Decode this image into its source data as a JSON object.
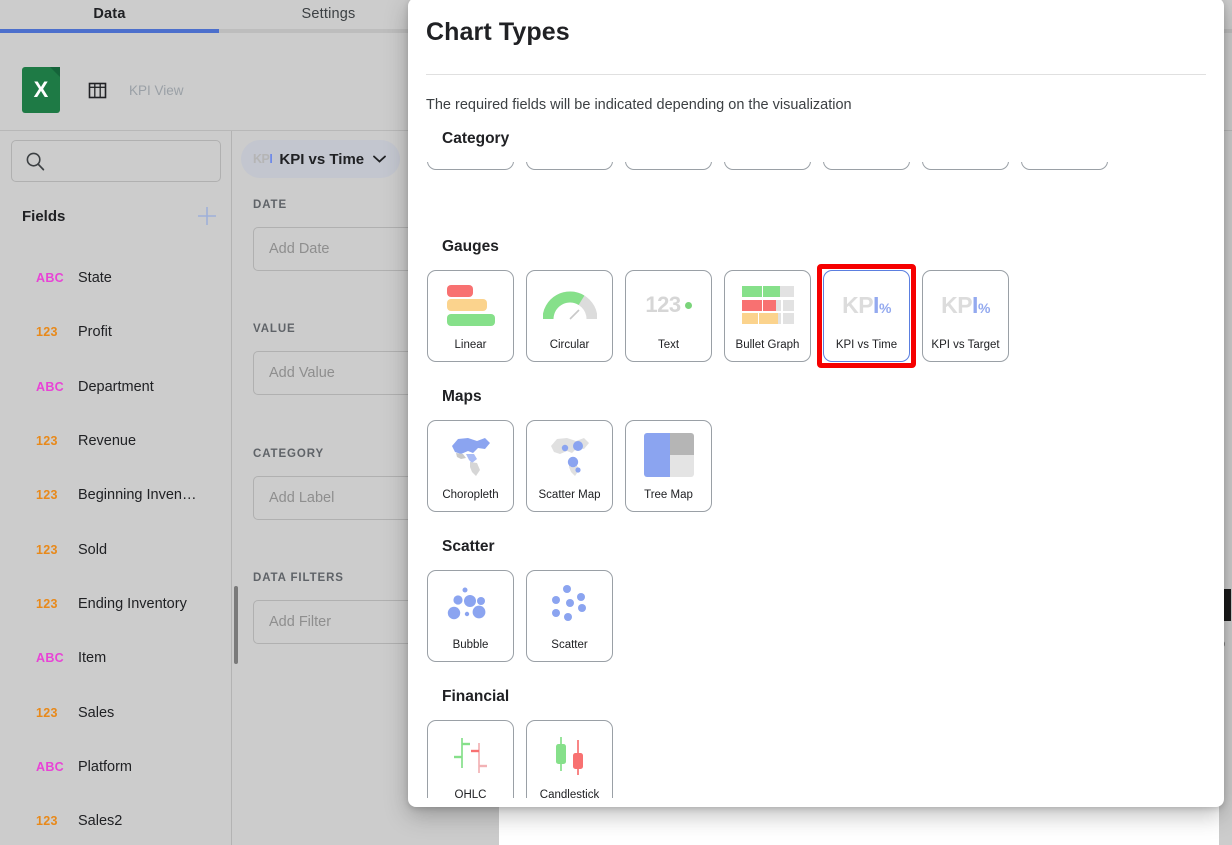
{
  "tabs": [
    {
      "label": "Data",
      "active": true
    },
    {
      "label": "Settings",
      "active": false
    }
  ],
  "source": {
    "icon": "excel-file-icon",
    "table_icon": "table-grid-icon",
    "name": "KPI View"
  },
  "sidebar": {
    "search_placeholder": "",
    "fields_title": "Fields",
    "add_field_label": "+",
    "fields": [
      {
        "type": "ABC",
        "name": "State"
      },
      {
        "type": "123",
        "name": "Profit"
      },
      {
        "type": "ABC",
        "name": "Department"
      },
      {
        "type": "123",
        "name": "Revenue"
      },
      {
        "type": "123",
        "name": "Beginning Inven…"
      },
      {
        "type": "123",
        "name": "Sold"
      },
      {
        "type": "123",
        "name": "Ending Inventory"
      },
      {
        "type": "ABC",
        "name": "Item"
      },
      {
        "type": "123",
        "name": "Sales"
      },
      {
        "type": "ABC",
        "name": "Platform"
      },
      {
        "type": "123",
        "name": "Sales2"
      }
    ]
  },
  "midpanel": {
    "viz_chip": {
      "glyph": "KPI",
      "label": "KPI vs Time",
      "caret": "chevron-down-icon"
    },
    "dropzones": [
      {
        "label": "DATE",
        "placeholder": "Add Date"
      },
      {
        "label": "VALUE",
        "placeholder": "Add Value"
      },
      {
        "label": "CATEGORY",
        "placeholder": "Add Label"
      },
      {
        "label": "DATA FILTERS",
        "placeholder": "Add Filter"
      }
    ]
  },
  "modal": {
    "title": "Chart Types",
    "subtitle": "The required fields will be indicated depending on the visualization",
    "sections": [
      {
        "title": "Category",
        "clipped": true,
        "cards": [
          {
            "name": "",
            "icon": "category-chart-1"
          },
          {
            "name": "",
            "icon": "category-chart-2"
          },
          {
            "name": "",
            "icon": "category-chart-3"
          },
          {
            "name": "",
            "icon": "category-chart-4"
          },
          {
            "name": "",
            "icon": "category-chart-5"
          },
          {
            "name": "",
            "icon": "category-chart-6"
          },
          {
            "name": "",
            "icon": "category-chart-7"
          }
        ]
      },
      {
        "title": "Gauges",
        "cards": [
          {
            "name": "Linear",
            "icon": "linear-gauge-icon",
            "selected": false
          },
          {
            "name": "Circular",
            "icon": "circular-gauge-icon",
            "selected": false
          },
          {
            "name": "Text",
            "icon": "text-gauge-icon",
            "selected": false
          },
          {
            "name": "Bullet Graph",
            "icon": "bullet-graph-icon",
            "selected": false
          },
          {
            "name": "KPI vs Time",
            "icon": "kpi-vs-time-icon",
            "selected": true
          },
          {
            "name": "KPI vs Target",
            "icon": "kpi-vs-target-icon",
            "selected": false
          }
        ]
      },
      {
        "title": "Maps",
        "cards": [
          {
            "name": "Choropleth",
            "icon": "choropleth-map-icon"
          },
          {
            "name": "Scatter Map",
            "icon": "scatter-map-icon"
          },
          {
            "name": "Tree Map",
            "icon": "tree-map-icon"
          }
        ]
      },
      {
        "title": "Scatter",
        "cards": [
          {
            "name": "Bubble",
            "icon": "bubble-chart-icon"
          },
          {
            "name": "Scatter",
            "icon": "scatter-chart-icon"
          }
        ]
      },
      {
        "title": "Financial",
        "clipped_bottom": true,
        "cards": [
          {
            "name": "OHLC",
            "icon": "ohlc-chart-icon"
          },
          {
            "name": "Candlestick",
            "icon": "candlestick-chart-icon"
          }
        ]
      }
    ]
  },
  "colors": {
    "accent_blue": "#4c6fcc",
    "selection_outline": "#f60000",
    "selection_border": "#5b7fe0",
    "abc_field": "#e843d6",
    "num_field": "#e8891a",
    "excel_green": "#1e7a45",
    "chart_green": "#7ad47a",
    "chart_red": "#f87171",
    "chart_yellow": "#fbd38d",
    "chart_blue": "#8ba4f0",
    "panel_gray": "#cccccc"
  }
}
